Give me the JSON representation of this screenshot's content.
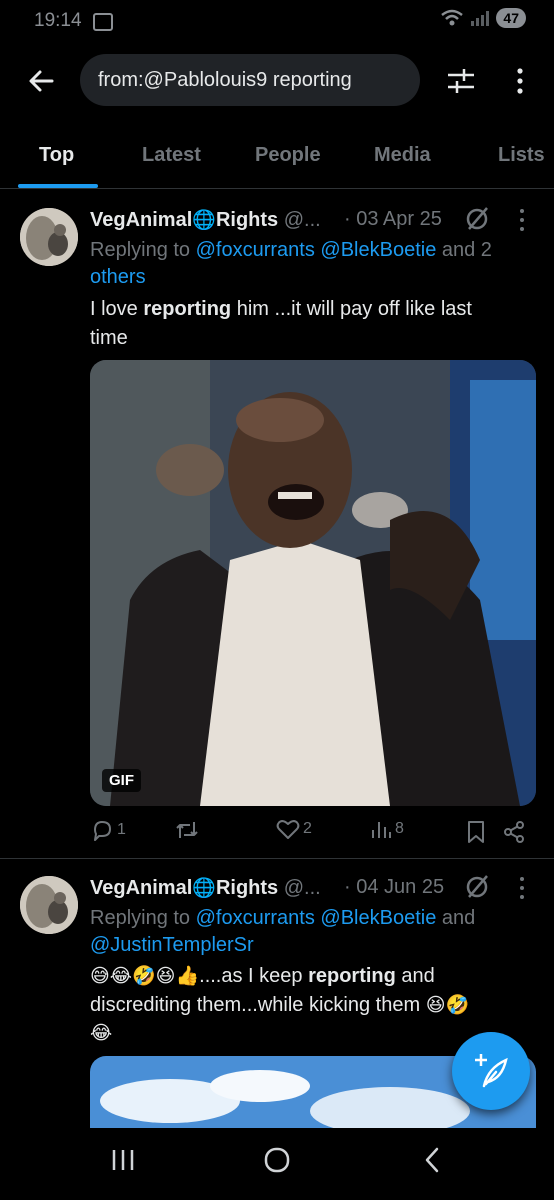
{
  "status_bar": {
    "time": "19:14",
    "battery": "47"
  },
  "search": {
    "query": "from:@Pablolouis9 reporting"
  },
  "tabs": [
    {
      "label": "Top"
    },
    {
      "label": "Latest"
    },
    {
      "label": "People"
    },
    {
      "label": "Media"
    },
    {
      "label": "Lists"
    }
  ],
  "tweets": [
    {
      "name": "VegAnimal",
      "name_suffix": "Rights",
      "handle": "@...",
      "date": "· 03 Apr 25",
      "reply_prefix": "Replying to ",
      "reply_to_1": "@foxcurrants @BlekBoetie",
      "reply_and": " and 2",
      "reply_line2": "others",
      "text_pre": "I love ",
      "text_bold": "reporting",
      "text_post": " him ...it will pay off like last",
      "text_line2": "time",
      "media_badge": "GIF",
      "replies": "1",
      "likes": "2",
      "views": "8"
    },
    {
      "name": "VegAnimal",
      "name_suffix": "Rights",
      "handle": "@...",
      "date": "· 04 Jun 25",
      "reply_prefix": "Replying to ",
      "reply_to_1": "@foxcurrants @BlekBoetie",
      "reply_and": " and",
      "reply_line2": "@JustinTemplerSr",
      "emojis": "😅😂🤣😆👍",
      "text_pre": "....as I keep ",
      "text_bold": "reporting",
      "text_post": " and",
      "text_line2": "discrediting them...while kicking them ",
      "text_line2_emojis": "😆🤣",
      "text_line3": "😂"
    }
  ],
  "colors": {
    "accent": "#1d9bf0",
    "background": "#000000",
    "muted": "#71767b"
  }
}
